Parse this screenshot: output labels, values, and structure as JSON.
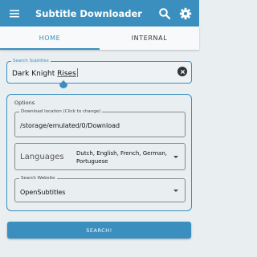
{
  "app": {
    "title": "Subtitle Downloader",
    "accent_color": "#3a8fbe",
    "icons": [
      "menu-icon",
      "search-icon",
      "settings-gear-icon"
    ]
  },
  "tabs": [
    {
      "label": "HOME",
      "active": true
    },
    {
      "label": "INTERNAL",
      "active": false
    }
  ],
  "search": {
    "legend": "Search Subtitles",
    "value_prefix": "Dark Knight ",
    "value_underlined": "Rises"
  },
  "options": {
    "label": "Options",
    "download": {
      "legend": "Download location (Click to change)",
      "value": "/storage/emulated/0/Download"
    },
    "languages": {
      "label": "Languages",
      "value": "Dutch, English, French, German, Portuguese"
    },
    "website": {
      "legend": "Search Website",
      "value": "OpenSubtitles"
    }
  },
  "search_button": {
    "label": "SEARCH!"
  }
}
